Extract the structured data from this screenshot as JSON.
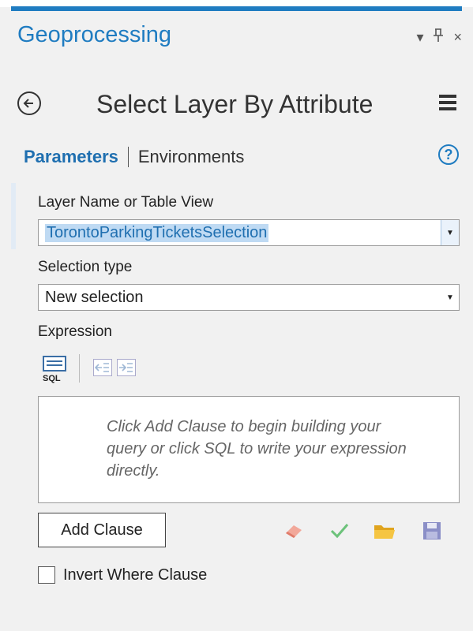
{
  "pane": {
    "title": "Geoprocessing",
    "controls": {
      "dropdown": "▾",
      "pin": "ᵖ",
      "close": "×"
    }
  },
  "tool": {
    "title": "Select Layer By Attribute"
  },
  "tabs": {
    "parameters": "Parameters",
    "environments": "Environments",
    "help": "?"
  },
  "params": {
    "layer_label": "Layer Name or Table View",
    "layer_value": "TorontoParkingTicketsSelection",
    "selection_type_label": "Selection type",
    "selection_type_value": "New selection",
    "expression_label": "Expression",
    "sql_icon_text": "SQL",
    "expression_hint": "Click Add Clause to begin building your query or click SQL to write your expression directly.",
    "add_clause": "Add Clause",
    "invert_label": "Invert Where Clause",
    "invert_checked": false
  },
  "colors": {
    "accent": "#1f7cc1",
    "selection_bg": "#bfdaf3"
  }
}
